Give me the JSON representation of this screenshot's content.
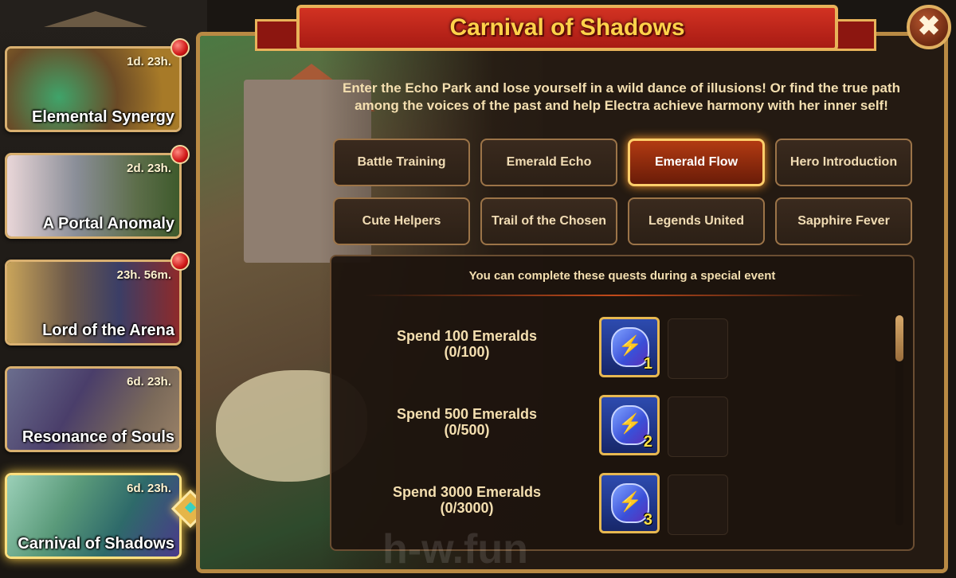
{
  "sidebar": {
    "events": [
      {
        "name": "Elemental Synergy",
        "time": "1d. 23h.",
        "notification": true,
        "selected": false
      },
      {
        "name": "A Portal Anomaly",
        "time": "2d. 23h.",
        "notification": true,
        "selected": false
      },
      {
        "name": "Lord of the Arena",
        "time": "23h. 56m.",
        "notification": true,
        "selected": false
      },
      {
        "name": "Resonance of Souls",
        "time": "6d. 23h.",
        "notification": false,
        "selected": false
      },
      {
        "name": "Carnival of Shadows",
        "time": "6d. 23h.",
        "notification": false,
        "selected": true
      }
    ]
  },
  "window": {
    "title": "Carnival of Shadows",
    "close_label": "✖",
    "description": "Enter the Echo Park and lose yourself in a wild dance of illusions! Or find the true path among the voices of the past and help Electra achieve harmony with her inner self!"
  },
  "tabs": [
    {
      "label": "Battle Training",
      "active": false
    },
    {
      "label": "Emerald Echo",
      "active": false
    },
    {
      "label": "Emerald Flow",
      "active": true
    },
    {
      "label": "Hero Introduction",
      "active": false
    },
    {
      "label": "Cute Helpers",
      "active": false
    },
    {
      "label": "Trail of the Chosen",
      "active": false
    },
    {
      "label": "Legends United",
      "active": false
    },
    {
      "label": "Sapphire Fever",
      "active": false
    }
  ],
  "quests": {
    "header": "You can complete these quests during a special event",
    "items": [
      {
        "title": "Spend 100 Emeralds",
        "progress": "(0/100)",
        "reward_icon": "lightning-gem-icon",
        "reward_qty": "1"
      },
      {
        "title": "Spend 500 Emeralds",
        "progress": "(0/500)",
        "reward_icon": "lightning-gem-icon",
        "reward_qty": "2"
      },
      {
        "title": "Spend 3000 Emeralds",
        "progress": "(0/3000)",
        "reward_icon": "lightning-gem-icon",
        "reward_qty": "3"
      }
    ]
  },
  "watermark": "h-w.fun",
  "colors": {
    "title_gold": "#ffd24a",
    "ribbon_red": "#c0281b",
    "frame_gold": "#b98a44",
    "active_tab": "#b23a12",
    "text_cream": "#f4dfb0"
  }
}
